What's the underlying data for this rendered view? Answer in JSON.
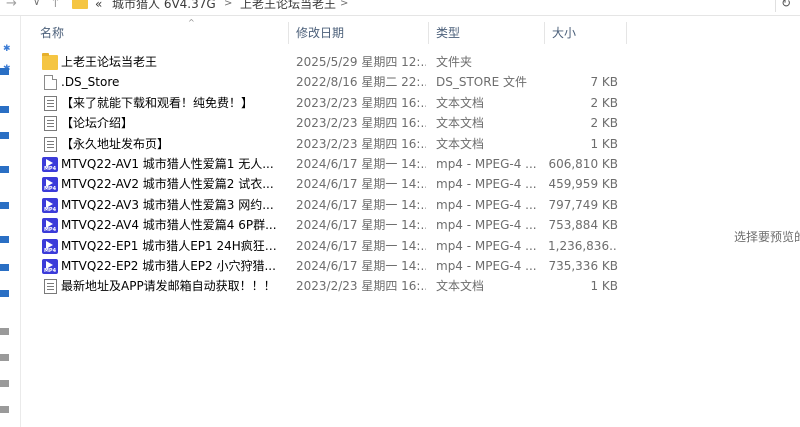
{
  "address": {
    "crumbs": [
      "«",
      "城市猎人 6V4.37G",
      "上老王论坛当老王"
    ],
    "separator": ">"
  },
  "columns": {
    "name": "名称",
    "date": "修改日期",
    "type": "类型",
    "size": "大小"
  },
  "files": [
    {
      "icon": "folder-icon",
      "name": "上老王论坛当老王",
      "date": "2025/5/29 星期四 12:...",
      "type": "文件夹",
      "size": ""
    },
    {
      "icon": "file-icon",
      "name": ".DS_Store",
      "date": "2022/8/16 星期二 22:...",
      "type": "DS_STORE 文件",
      "size": "7 KB"
    },
    {
      "icon": "text-file-icon",
      "name": "【来了就能下载和观看！纯免费！】",
      "date": "2023/2/23 星期四 16:...",
      "type": "文本文档",
      "size": "2 KB"
    },
    {
      "icon": "text-file-icon",
      "name": "【论坛介绍】",
      "date": "2023/2/23 星期四 16:...",
      "type": "文本文档",
      "size": "2 KB"
    },
    {
      "icon": "text-file-icon",
      "name": "【永久地址发布页】",
      "date": "2023/2/23 星期四 16:...",
      "type": "文本文档",
      "size": "1 KB"
    },
    {
      "icon": "mp4-file-icon",
      "name": "MTVQ22-AV1  城市猎人性爱篇1 无人...",
      "date": "2024/6/17 星期一 14:...",
      "type": "mp4 - MPEG-4 ...",
      "size": "606,810 KB"
    },
    {
      "icon": "mp4-file-icon",
      "name": "MTVQ22-AV2  城市猎人性爱篇2 试衣...",
      "date": "2024/6/17 星期一 14:...",
      "type": "mp4 - MPEG-4 ...",
      "size": "459,959 KB"
    },
    {
      "icon": "mp4-file-icon",
      "name": "MTVQ22-AV3  城市猎人性爱篇3 网约...",
      "date": "2024/6/17 星期一 14:...",
      "type": "mp4 - MPEG-4 ...",
      "size": "797,749 KB"
    },
    {
      "icon": "mp4-file-icon",
      "name": "MTVQ22-AV4  城市猎人性爱篇4 6P群...",
      "date": "2024/6/17 星期一 14:...",
      "type": "mp4 - MPEG-4 ...",
      "size": "753,884 KB"
    },
    {
      "icon": "mp4-file-icon",
      "name": "MTVQ22-EP1  城市猎人EP1 24H疯狂约...",
      "date": "2024/6/17 星期一 14:...",
      "type": "mp4 - MPEG-4 ...",
      "size": "1,236,836..."
    },
    {
      "icon": "mp4-file-icon",
      "name": "MTVQ22-EP2  城市猎人EP2  小穴狩猎...",
      "date": "2024/6/17 星期一 14:...",
      "type": "mp4 - MPEG-4 ...",
      "size": "735,336 KB"
    },
    {
      "icon": "text-file-icon",
      "name": "最新地址及APP请发邮箱自动获取！！！",
      "date": "2023/2/23 星期四 16:...",
      "type": "文本文档",
      "size": "1 KB"
    }
  ],
  "preview": {
    "text": "选择要预览的"
  },
  "mp4_badge": "MP4",
  "colors": {
    "folder": "#f5c542",
    "mp4": "#3b3bd9",
    "header_text": "#4c607a",
    "nav_mark": "#2a6fc4"
  }
}
